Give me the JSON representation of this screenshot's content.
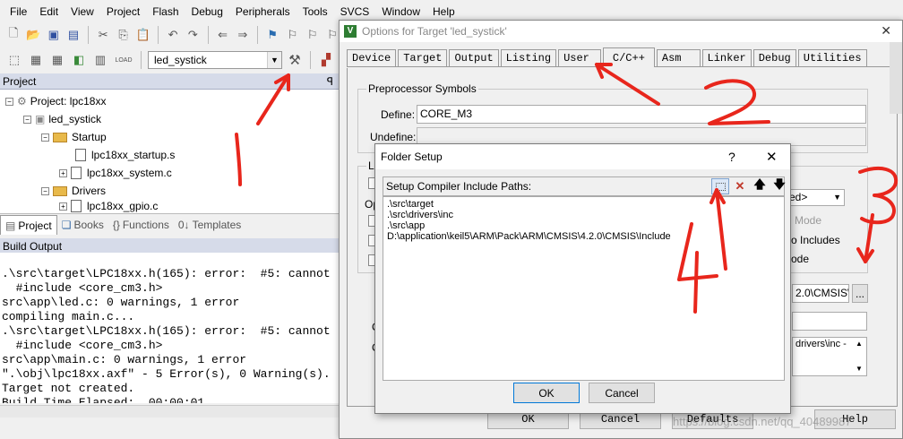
{
  "menu": [
    "File",
    "Edit",
    "View",
    "Project",
    "Flash",
    "Debug",
    "Peripherals",
    "Tools",
    "SVCS",
    "Window",
    "Help"
  ],
  "toolbar": {
    "target": "led_systick",
    "load_label": "LOAD"
  },
  "project_panel": {
    "title": "Project",
    "pin": "ᵖ",
    "tree": [
      {
        "label": "Project: lpc18xx"
      },
      {
        "label": "led_systick"
      },
      {
        "label": "Startup"
      },
      {
        "label": "lpc18xx_startup.s"
      },
      {
        "label": "lpc18xx_system.c"
      },
      {
        "label": "Drivers"
      },
      {
        "label": "lpc18xx_gpio.c"
      }
    ],
    "tabs": [
      "Project",
      "Books",
      "Functions",
      "Templates"
    ]
  },
  "build_output": {
    "title": "Build Output",
    "lines": [
      ".\\src\\target\\LPC18xx.h(165): error:  #5: cannot",
      "  #include <core_cm3.h>                          /",
      "src\\app\\led.c: 0 warnings, 1 error",
      "compiling main.c...",
      ".\\src\\target\\LPC18xx.h(165): error:  #5: cannot",
      "  #include <core_cm3.h>                          /",
      "src\\app\\main.c: 0 warnings, 1 error",
      "\".\\obj\\lpc18xx.axf\" - 5 Error(s), 0 Warning(s).",
      "Target not created.",
      "Build Time Elapsed:  00:00:01"
    ]
  },
  "options_dialog": {
    "title": "Options for Target 'led_systick'",
    "icon_letter": "V",
    "tabs": [
      "Device",
      "Target",
      "Output",
      "Listing",
      "User",
      "C/C++",
      "Asm",
      "Linker",
      "Debug",
      "Utilities"
    ],
    "active_tab": "C/C++",
    "preprocessor_group": "Preprocessor Symbols",
    "define_label": "Define:",
    "define_value": "CORE_M3",
    "undefine_label": "Undefine:",
    "lang_group_label": "La",
    "opt_label": "Op",
    "combo_value": "ed>",
    "mode_label": "Mode",
    "includes_label": "o Includes",
    "ode_label": "ode",
    "include_paths_value": "2.0\\CMSIS\\",
    "browse_label": "...",
    "misc_value": "drivers\\inc -",
    "side_c1": "C",
    "side_c2": "C",
    "buttons": {
      "ok": "OK",
      "cancel": "Cancel",
      "defaults": "Defaults",
      "help": "Help"
    },
    "watermark": "https://blog.csdn.net/qq_40489987"
  },
  "folder_setup": {
    "title": "Folder Setup",
    "help": "?",
    "close": "✕",
    "header_label": "Setup Compiler Include Paths:",
    "paths": [
      ".\\src\\target",
      ".\\src\\drivers\\inc",
      ".\\src\\app",
      "D:\\application\\keil5\\ARM\\Pack\\ARM\\CMSIS\\4.2.0\\CMSIS\\Include"
    ],
    "ok_label": "OK",
    "cancel_label": "Cancel"
  },
  "annotation_color": "#e8261c"
}
